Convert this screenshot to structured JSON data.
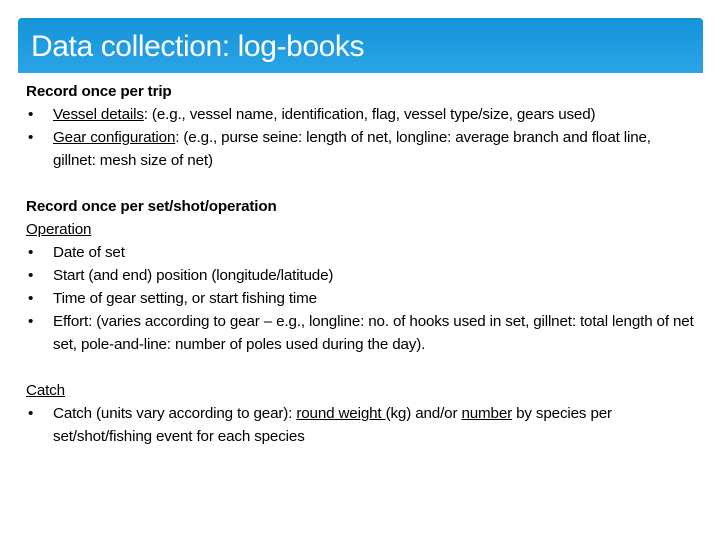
{
  "slide": {
    "title": "Data collection: log-books",
    "header_color": "#1a96dc",
    "bullet_glyph": "•"
  },
  "trip": {
    "heading": "Record once per trip",
    "items": [
      {
        "label": "Vessel details",
        "text": ": (e.g., vessel name, identification, flag, vessel type/size, gears used)"
      },
      {
        "label": "Gear configuration",
        "text": ": (e.g., purse seine: length of net, longline: average branch and float line, gillnet: mesh size of net)"
      }
    ]
  },
  "set": {
    "heading": "Record once per set/shot/operation",
    "operation": {
      "subheading": "Operation",
      "items": [
        "Date of set",
        "Start (and end) position (longitude/latitude)",
        "Time of gear setting, or start fishing time",
        "Effort: (varies according to gear – e.g., longline: no. of hooks used in set, gillnet: total length of net set, pole-and-line: number of poles used during the day)."
      ]
    },
    "catch": {
      "subheading": "Catch",
      "item": {
        "prefix": "Catch (units vary according to gear): ",
        "term1": "round weight ",
        "middle": "(kg) and/or ",
        "term2": "number",
        "suffix": " by species per set/shot/fishing event for each species"
      }
    }
  }
}
